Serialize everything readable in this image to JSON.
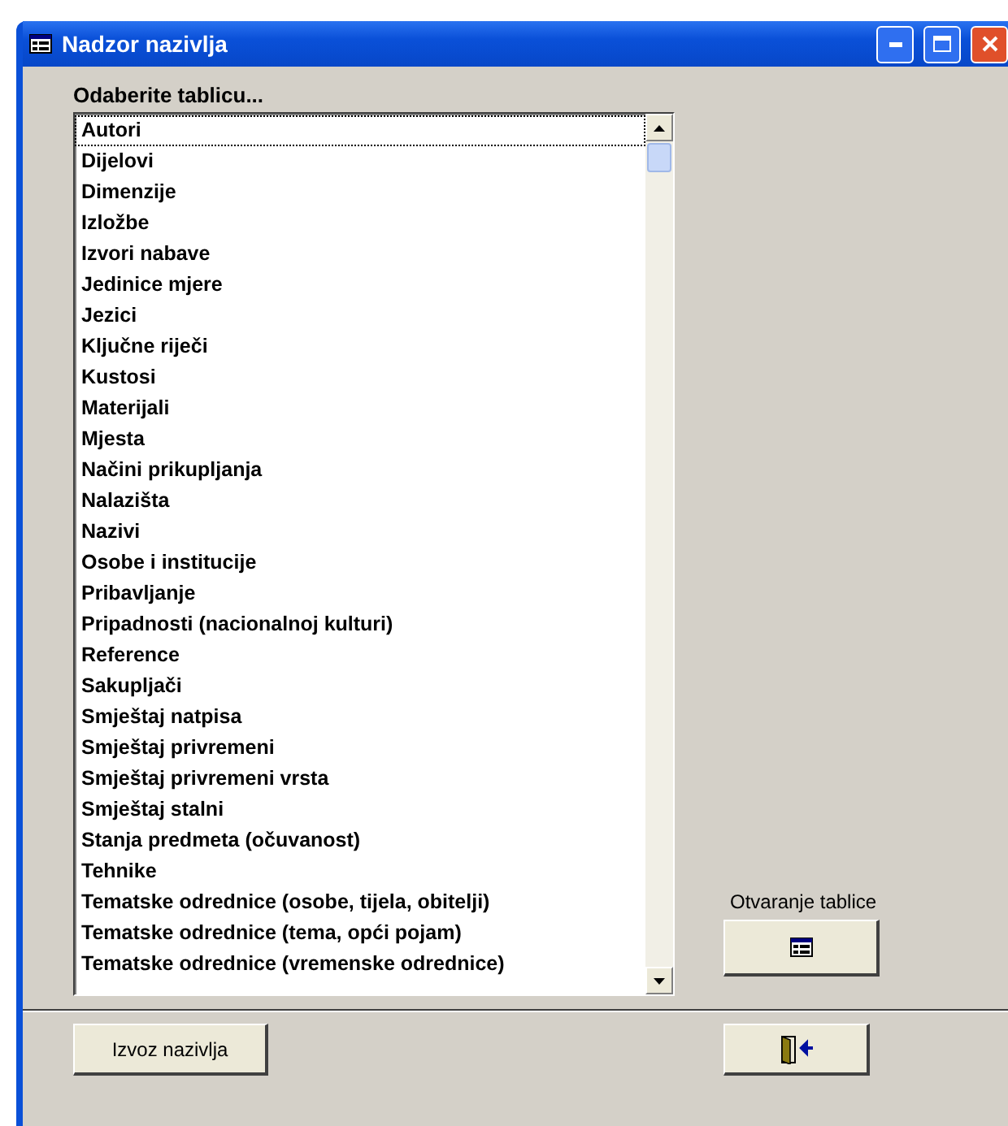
{
  "window": {
    "title": "Nadzor nazivlja"
  },
  "list_label": "Odaberite tablicu...",
  "tables": [
    {
      "label": "Autori",
      "selected": true
    },
    {
      "label": "Dijelovi",
      "selected": false
    },
    {
      "label": "Dimenzije",
      "selected": false
    },
    {
      "label": "Izložbe",
      "selected": false
    },
    {
      "label": "Izvori nabave",
      "selected": false
    },
    {
      "label": "Jedinice mjere",
      "selected": false
    },
    {
      "label": "Jezici",
      "selected": false
    },
    {
      "label": "Ključne riječi",
      "selected": false
    },
    {
      "label": "Kustosi",
      "selected": false
    },
    {
      "label": "Materijali",
      "selected": false
    },
    {
      "label": "Mjesta",
      "selected": false
    },
    {
      "label": "Načini prikupljanja",
      "selected": false
    },
    {
      "label": "Nalazišta",
      "selected": false
    },
    {
      "label": "Nazivi",
      "selected": false
    },
    {
      "label": "Osobe i institucije",
      "selected": false
    },
    {
      "label": "Pribavljanje",
      "selected": false
    },
    {
      "label": "Pripadnosti (nacionalnoj kulturi)",
      "selected": false
    },
    {
      "label": "Reference",
      "selected": false
    },
    {
      "label": "Sakupljači",
      "selected": false
    },
    {
      "label": "Smještaj natpisa",
      "selected": false
    },
    {
      "label": "Smještaj privremeni",
      "selected": false
    },
    {
      "label": "Smještaj privremeni vrsta",
      "selected": false
    },
    {
      "label": "Smještaj stalni",
      "selected": false
    },
    {
      "label": "Stanja predmeta (očuvanost)",
      "selected": false
    },
    {
      "label": "Tehnike",
      "selected": false
    },
    {
      "label": "Tematske odrednice (osobe, tijela, obitelji)",
      "selected": false
    },
    {
      "label": "Tematske odrednice (tema, opći pojam)",
      "selected": false
    },
    {
      "label": "Tematske odrednice (vremenske odrednice)",
      "selected": false
    }
  ],
  "open_table": {
    "label": "Otvaranje tablice"
  },
  "export_button": {
    "label": "Izvoz nazivlja"
  }
}
